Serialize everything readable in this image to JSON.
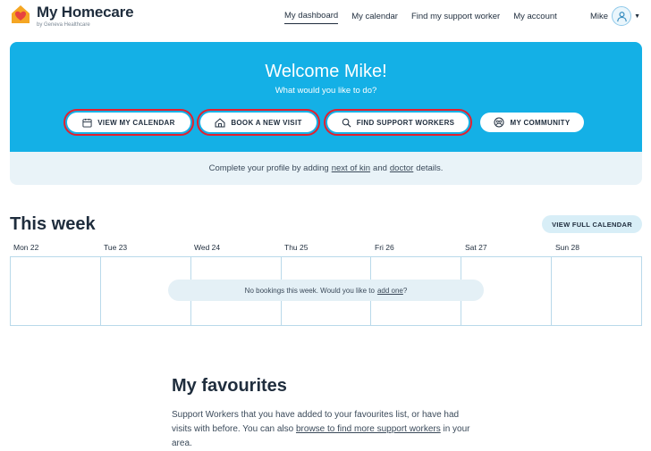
{
  "header": {
    "brand": "My Homecare",
    "brand_sub": "by Geneva Healthcare",
    "nav": [
      {
        "label": "My dashboard",
        "active": true
      },
      {
        "label": "My calendar"
      },
      {
        "label": "Find my support worker"
      },
      {
        "label": "My account"
      }
    ],
    "user_name": "Mike"
  },
  "hero": {
    "title": "Welcome Mike!",
    "subtitle": "What would you like to do?",
    "actions": [
      {
        "label": "VIEW MY CALENDAR",
        "icon": "calendar-icon"
      },
      {
        "label": "BOOK A NEW VISIT",
        "icon": "home-icon"
      },
      {
        "label": "FIND SUPPORT WORKERS",
        "icon": "search-icon"
      },
      {
        "label": "MY COMMUNITY",
        "icon": "community-icon"
      }
    ]
  },
  "profile_prompt": {
    "prefix": "Complete your profile by adding",
    "link1": "next of kin",
    "and": "and",
    "link2": "doctor",
    "suffix": "details."
  },
  "week": {
    "title": "This week",
    "full_calendar_label": "VIEW FULL CALENDAR",
    "days": [
      "Mon 22",
      "Tue 23",
      "Wed 24",
      "Thu 25",
      "Fri 26",
      "Sat 27",
      "Sun 28"
    ],
    "empty_text": "No bookings this week. Would you like to",
    "empty_link": "add one",
    "empty_suffix": "?"
  },
  "favourites": {
    "title": "My favourites",
    "text": "Support Workers that you have added to your favourites list, or have had visits with before. You can also",
    "link": "browse to find more support workers",
    "suffix": "in your area."
  },
  "colors": {
    "hero": "#14b0e6",
    "highlight": "#e3202e",
    "strip": "#e9f3f8",
    "logo_house": "#f5a623",
    "logo_heart": "#e8433f"
  }
}
